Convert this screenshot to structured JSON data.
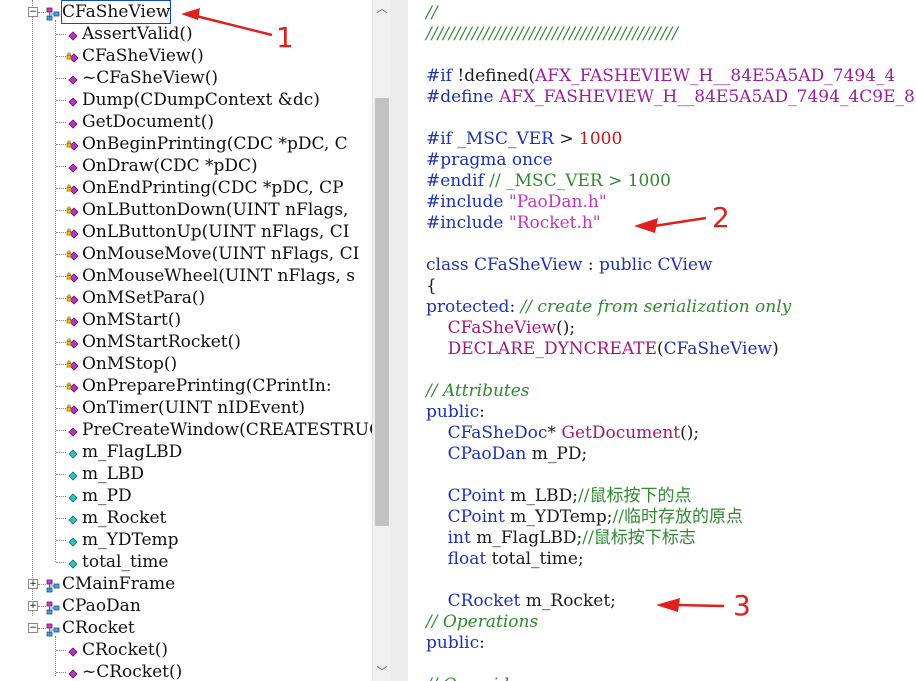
{
  "class_tree": {
    "items": [
      {
        "label": "CFaSheView",
        "level": 0,
        "expanded": true,
        "icon": "class-icon",
        "selected": true
      },
      {
        "label": "AssertValid()",
        "level": 1,
        "icon": "public-method-icon"
      },
      {
        "label": "CFaSheView()",
        "level": 1,
        "icon": "protected-method-icon"
      },
      {
        "label": "~CFaSheView()",
        "level": 1,
        "icon": "public-method-icon"
      },
      {
        "label": "Dump(CDumpContext &dc)",
        "level": 1,
        "icon": "public-method-icon"
      },
      {
        "label": "GetDocument()",
        "level": 1,
        "icon": "public-method-icon"
      },
      {
        "label": "OnBeginPrinting(CDC *pDC, C",
        "level": 1,
        "icon": "protected-method-icon"
      },
      {
        "label": "OnDraw(CDC *pDC)",
        "level": 1,
        "icon": "public-method-icon"
      },
      {
        "label": "OnEndPrinting(CDC *pDC, CP",
        "level": 1,
        "icon": "protected-method-icon"
      },
      {
        "label": "OnLButtonDown(UINT nFlags,",
        "level": 1,
        "icon": "protected-method-icon"
      },
      {
        "label": "OnLButtonUp(UINT nFlags, CI",
        "level": 1,
        "icon": "protected-method-icon"
      },
      {
        "label": "OnMouseMove(UINT nFlags, CI",
        "level": 1,
        "icon": "protected-method-icon"
      },
      {
        "label": "OnMouseWheel(UINT nFlags, s",
        "level": 1,
        "icon": "protected-method-icon"
      },
      {
        "label": "OnMSetPara()",
        "level": 1,
        "icon": "protected-method-icon"
      },
      {
        "label": "OnMStart()",
        "level": 1,
        "icon": "protected-method-icon"
      },
      {
        "label": "OnMStartRocket()",
        "level": 1,
        "icon": "protected-method-icon"
      },
      {
        "label": "OnMStop()",
        "level": 1,
        "icon": "protected-method-icon"
      },
      {
        "label": "OnPreparePrinting(CPrintIn:",
        "level": 1,
        "icon": "protected-method-icon"
      },
      {
        "label": "OnTimer(UINT nIDEvent)",
        "level": 1,
        "icon": "protected-method-icon"
      },
      {
        "label": "PreCreateWindow(CREATESTRUC",
        "level": 1,
        "icon": "public-method-icon"
      },
      {
        "label": "m_FlagLBD",
        "level": 1,
        "icon": "member-variable-icon"
      },
      {
        "label": "m_LBD",
        "level": 1,
        "icon": "member-variable-icon"
      },
      {
        "label": "m_PD",
        "level": 1,
        "icon": "member-variable-icon"
      },
      {
        "label": "m_Rocket",
        "level": 1,
        "icon": "member-variable-icon"
      },
      {
        "label": "m_YDTemp",
        "level": 1,
        "icon": "member-variable-icon"
      },
      {
        "label": "total_time",
        "level": 1,
        "icon": "member-variable-icon"
      },
      {
        "label": "CMainFrame",
        "level": 0,
        "expanded": false,
        "icon": "class-icon"
      },
      {
        "label": "CPaoDan",
        "level": 0,
        "expanded": false,
        "icon": "class-icon"
      },
      {
        "label": "CRocket",
        "level": 0,
        "expanded": true,
        "icon": "class-icon"
      },
      {
        "label": "CRocket()",
        "level": 1,
        "icon": "public-method-icon"
      },
      {
        "label": "~CRocket()",
        "level": 1,
        "icon": "public-method-icon"
      }
    ]
  },
  "code": {
    "lines": [
      [
        [
          "//",
          "cmt"
        ]
      ],
      [
        [
          "////////////////////////////////////////////",
          "cmt"
        ]
      ],
      [],
      [
        [
          "#if ",
          "dir"
        ],
        [
          "!defined(",
          "txt"
        ],
        [
          "AFX_FASHEVIEW_H__84E5A5AD_7494_4",
          "mac"
        ]
      ],
      [
        [
          "#define ",
          "dir"
        ],
        [
          "AFX_FASHEVIEW_H__84E5A5AD_7494_4C9E_8",
          "mac"
        ]
      ],
      [],
      [
        [
          "#if ",
          "dir"
        ],
        [
          "_MSC_VER ",
          "ident"
        ],
        [
          "> ",
          "txt"
        ],
        [
          "1000",
          "num"
        ]
      ],
      [
        [
          "#pragma once",
          "dir"
        ]
      ],
      [
        [
          "#endif ",
          "dir"
        ],
        [
          "// _MSC_VER > 1000",
          "cmt2"
        ]
      ],
      [
        [
          "#include ",
          "dir"
        ],
        [
          "\"PaoDan.h\"",
          "str"
        ]
      ],
      [
        [
          "#include ",
          "dir"
        ],
        [
          "\"Rocket.h\"",
          "str"
        ]
      ],
      [],
      [
        [
          "class ",
          "kw"
        ],
        [
          "CFaSheView ",
          "ident"
        ],
        [
          ": ",
          "txt"
        ],
        [
          "public ",
          "kw"
        ],
        [
          "CView",
          "ident"
        ]
      ],
      [
        [
          "{",
          "txt"
        ]
      ],
      [
        [
          "protected",
          "kw"
        ],
        [
          ": ",
          "txt"
        ],
        [
          "// create from serialization only",
          "cmt"
        ]
      ],
      [
        [
          "    CFaSheView",
          "fn"
        ],
        [
          "();",
          "txt"
        ]
      ],
      [
        [
          "    DECLARE_DYNCREATE",
          "fn"
        ],
        [
          "(",
          "txt"
        ],
        [
          "CFaSheView",
          "ident"
        ],
        [
          ")",
          "txt"
        ]
      ],
      [],
      [
        [
          "// Attributes",
          "cmt"
        ]
      ],
      [
        [
          "public",
          "kw"
        ],
        [
          ":",
          "txt"
        ]
      ],
      [
        [
          "    CFaSheDoc",
          "ident"
        ],
        [
          "* ",
          "txt"
        ],
        [
          "GetDocument",
          "fn"
        ],
        [
          "();",
          "txt"
        ]
      ],
      [
        [
          "    CPaoDan ",
          "ident"
        ],
        [
          "m_PD;",
          "txt"
        ]
      ],
      [],
      [
        [
          "    CPoint ",
          "ident"
        ],
        [
          "m_LBD;",
          "txt"
        ],
        [
          "//鼠标按下的点",
          "cmt2"
        ]
      ],
      [
        [
          "    CPoint ",
          "ident"
        ],
        [
          "m_YDTemp;",
          "txt"
        ],
        [
          "//临时存放的原点",
          "cmt2"
        ]
      ],
      [
        [
          "    int ",
          "kw"
        ],
        [
          "m_FlagLBD;",
          "txt"
        ],
        [
          "//鼠标按下标志",
          "cmt2"
        ]
      ],
      [
        [
          "    float ",
          "kw"
        ],
        [
          "total_time;",
          "txt"
        ]
      ],
      [],
      [
        [
          "    CRocket ",
          "ident"
        ],
        [
          "m_Rocket;",
          "txt"
        ]
      ],
      [
        [
          "// Operations",
          "cmt"
        ]
      ],
      [
        [
          "public",
          "kw"
        ],
        [
          ":",
          "txt"
        ]
      ],
      [],
      [
        [
          "// Overrides",
          "cmt"
        ]
      ]
    ]
  },
  "annotations": [
    {
      "label": "1"
    },
    {
      "label": "2"
    },
    {
      "label": "3"
    }
  ],
  "colors": {
    "annotation_red": "#e0201d",
    "keyword_blue": "#1b33b2",
    "macro_purple": "#9b1e9c",
    "comment_green": "#2f8a2f",
    "string_pink": "#c735c2",
    "number_red": "#c01818"
  }
}
